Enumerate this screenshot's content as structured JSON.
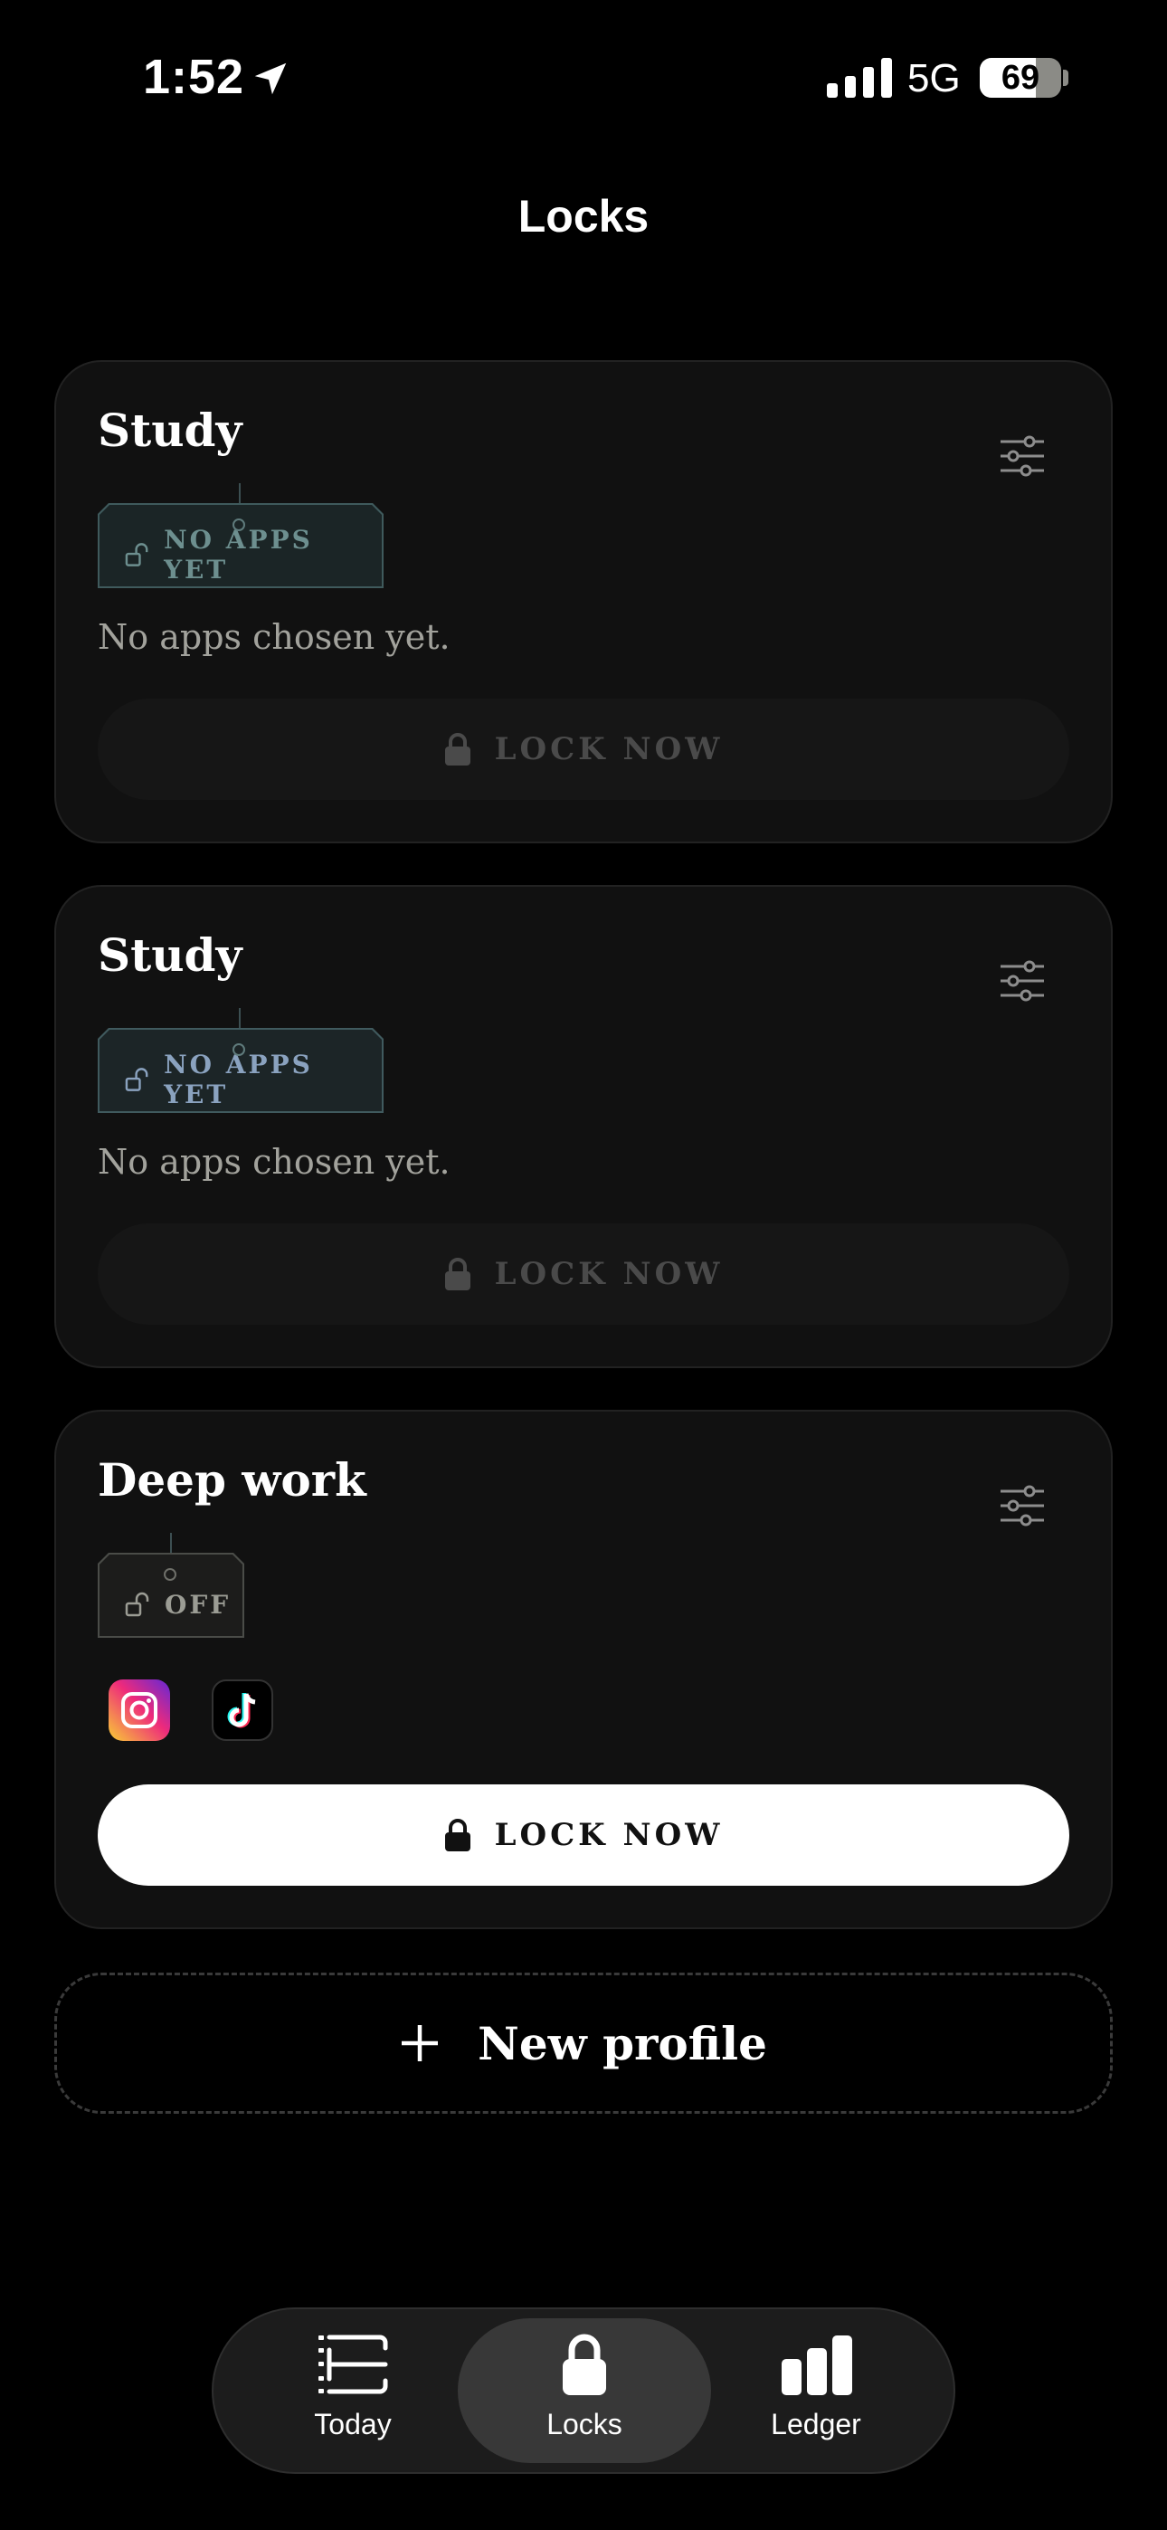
{
  "status": {
    "time": "1:52",
    "network": "5G",
    "battery": "69",
    "battery_level": 0.69
  },
  "header": {
    "title": "Locks"
  },
  "profiles": [
    {
      "name": "Study",
      "tag": "NO APPS YET",
      "empty_text": "No apps chosen yet.",
      "lock_label": "LOCK NOW"
    },
    {
      "name": "Study",
      "tag": "NO APPS YET",
      "empty_text": "No apps chosen yet.",
      "lock_label": "LOCK NOW"
    },
    {
      "name": "Deep work",
      "tag": "OFF",
      "apps": [
        "instagram-icon",
        "tiktok-icon"
      ],
      "lock_label": "LOCK NOW"
    }
  ],
  "new_profile": {
    "label": "New profile"
  },
  "tabs": [
    {
      "label": "Today"
    },
    {
      "label": "Locks"
    },
    {
      "label": "Ledger"
    }
  ],
  "colors": {
    "background": "#000000",
    "card": "#111111",
    "tag_teal": "#6d8f8f",
    "tag_blue": "#8aa2bf"
  }
}
